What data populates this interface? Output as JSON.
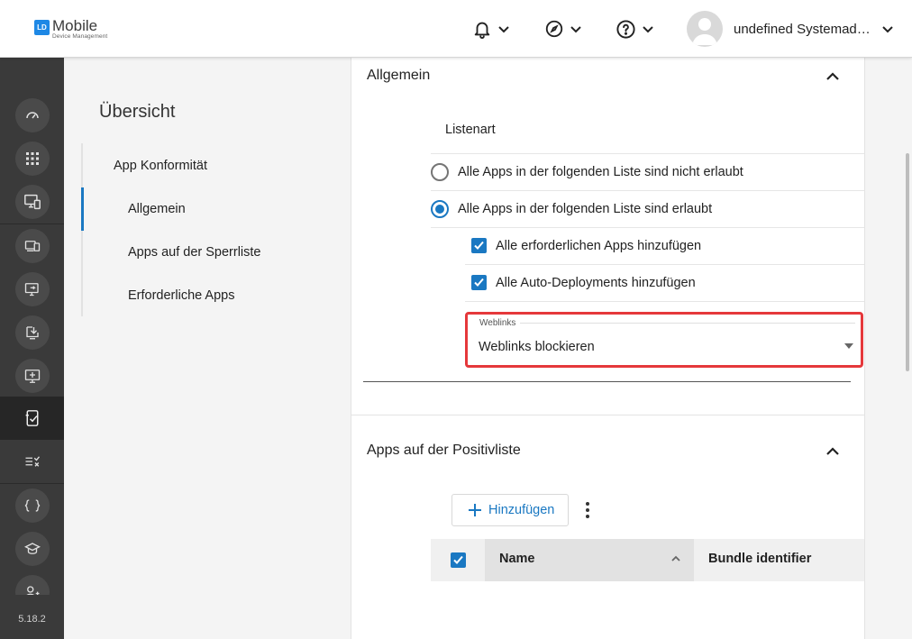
{
  "header": {
    "logo_title": "Mobile",
    "logo_subtitle": "Device Management",
    "logo_mark": "LD",
    "user_name": "undefined Systemadmi..."
  },
  "icons": {
    "notifications": "bell-icon",
    "compass": "compass-icon",
    "help": "help-circle-icon",
    "user": "avatar-icon"
  },
  "sidebar": {
    "items": [
      {
        "name": "dashboard-icon"
      },
      {
        "name": "apps-grid-icon"
      },
      {
        "name": "device-management-icon"
      },
      {
        "name": "devices-icon"
      },
      {
        "name": "remote-screen-icon"
      },
      {
        "name": "download-install-icon"
      },
      {
        "name": "add-screen-icon"
      },
      {
        "name": "compliance-icon",
        "active": true
      },
      {
        "name": "rules-icon"
      },
      {
        "name": "scripts-icon"
      },
      {
        "name": "education-icon"
      },
      {
        "name": "users-icon"
      }
    ],
    "version": "5.18.2"
  },
  "overview": {
    "title": "Übersicht",
    "items": [
      {
        "label": "App Konformität",
        "level": 1
      },
      {
        "label": "Allgemein",
        "level": 2,
        "active": true
      },
      {
        "label": "Apps auf der Sperrliste",
        "level": 2
      },
      {
        "label": "Erforderliche Apps",
        "level": 2
      }
    ]
  },
  "general_section": {
    "title": "Allgemein",
    "list_type_label": "Listenart",
    "options": [
      {
        "label": "Alle Apps in der folgenden Liste sind nicht erlaubt",
        "selected": false
      },
      {
        "label": "Alle Apps in der folgenden Liste sind erlaubt",
        "selected": true
      }
    ],
    "checks": [
      {
        "label": "Alle erforderlichen Apps hinzufügen",
        "checked": true
      },
      {
        "label": "Alle Auto-Deployments hinzufügen",
        "checked": true
      }
    ],
    "weblinks": {
      "legend": "Weblinks",
      "value": "Weblinks blockieren"
    }
  },
  "positive_section": {
    "title": "Apps auf der Positivliste",
    "add_label": "Hinzufügen",
    "table": {
      "columns": [
        "Name",
        "Bundle identifier"
      ]
    }
  },
  "colors": {
    "accent": "#1a78c2",
    "highlight": "#e5383b",
    "sidebar": "#3a3a3a"
  }
}
